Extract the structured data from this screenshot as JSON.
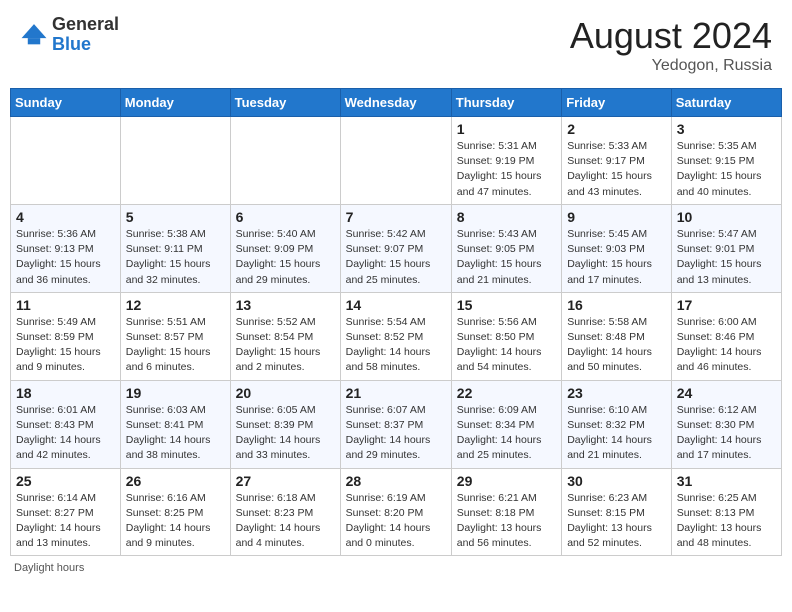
{
  "header": {
    "logo_general": "General",
    "logo_blue": "Blue",
    "month_year": "August 2024",
    "location": "Yedogon, Russia"
  },
  "days_of_week": [
    "Sunday",
    "Monday",
    "Tuesday",
    "Wednesday",
    "Thursday",
    "Friday",
    "Saturday"
  ],
  "weeks": [
    [
      {
        "num": "",
        "info": ""
      },
      {
        "num": "",
        "info": ""
      },
      {
        "num": "",
        "info": ""
      },
      {
        "num": "",
        "info": ""
      },
      {
        "num": "1",
        "info": "Sunrise: 5:31 AM\nSunset: 9:19 PM\nDaylight: 15 hours\nand 47 minutes."
      },
      {
        "num": "2",
        "info": "Sunrise: 5:33 AM\nSunset: 9:17 PM\nDaylight: 15 hours\nand 43 minutes."
      },
      {
        "num": "3",
        "info": "Sunrise: 5:35 AM\nSunset: 9:15 PM\nDaylight: 15 hours\nand 40 minutes."
      }
    ],
    [
      {
        "num": "4",
        "info": "Sunrise: 5:36 AM\nSunset: 9:13 PM\nDaylight: 15 hours\nand 36 minutes."
      },
      {
        "num": "5",
        "info": "Sunrise: 5:38 AM\nSunset: 9:11 PM\nDaylight: 15 hours\nand 32 minutes."
      },
      {
        "num": "6",
        "info": "Sunrise: 5:40 AM\nSunset: 9:09 PM\nDaylight: 15 hours\nand 29 minutes."
      },
      {
        "num": "7",
        "info": "Sunrise: 5:42 AM\nSunset: 9:07 PM\nDaylight: 15 hours\nand 25 minutes."
      },
      {
        "num": "8",
        "info": "Sunrise: 5:43 AM\nSunset: 9:05 PM\nDaylight: 15 hours\nand 21 minutes."
      },
      {
        "num": "9",
        "info": "Sunrise: 5:45 AM\nSunset: 9:03 PM\nDaylight: 15 hours\nand 17 minutes."
      },
      {
        "num": "10",
        "info": "Sunrise: 5:47 AM\nSunset: 9:01 PM\nDaylight: 15 hours\nand 13 minutes."
      }
    ],
    [
      {
        "num": "11",
        "info": "Sunrise: 5:49 AM\nSunset: 8:59 PM\nDaylight: 15 hours\nand 9 minutes."
      },
      {
        "num": "12",
        "info": "Sunrise: 5:51 AM\nSunset: 8:57 PM\nDaylight: 15 hours\nand 6 minutes."
      },
      {
        "num": "13",
        "info": "Sunrise: 5:52 AM\nSunset: 8:54 PM\nDaylight: 15 hours\nand 2 minutes."
      },
      {
        "num": "14",
        "info": "Sunrise: 5:54 AM\nSunset: 8:52 PM\nDaylight: 14 hours\nand 58 minutes."
      },
      {
        "num": "15",
        "info": "Sunrise: 5:56 AM\nSunset: 8:50 PM\nDaylight: 14 hours\nand 54 minutes."
      },
      {
        "num": "16",
        "info": "Sunrise: 5:58 AM\nSunset: 8:48 PM\nDaylight: 14 hours\nand 50 minutes."
      },
      {
        "num": "17",
        "info": "Sunrise: 6:00 AM\nSunset: 8:46 PM\nDaylight: 14 hours\nand 46 minutes."
      }
    ],
    [
      {
        "num": "18",
        "info": "Sunrise: 6:01 AM\nSunset: 8:43 PM\nDaylight: 14 hours\nand 42 minutes."
      },
      {
        "num": "19",
        "info": "Sunrise: 6:03 AM\nSunset: 8:41 PM\nDaylight: 14 hours\nand 38 minutes."
      },
      {
        "num": "20",
        "info": "Sunrise: 6:05 AM\nSunset: 8:39 PM\nDaylight: 14 hours\nand 33 minutes."
      },
      {
        "num": "21",
        "info": "Sunrise: 6:07 AM\nSunset: 8:37 PM\nDaylight: 14 hours\nand 29 minutes."
      },
      {
        "num": "22",
        "info": "Sunrise: 6:09 AM\nSunset: 8:34 PM\nDaylight: 14 hours\nand 25 minutes."
      },
      {
        "num": "23",
        "info": "Sunrise: 6:10 AM\nSunset: 8:32 PM\nDaylight: 14 hours\nand 21 minutes."
      },
      {
        "num": "24",
        "info": "Sunrise: 6:12 AM\nSunset: 8:30 PM\nDaylight: 14 hours\nand 17 minutes."
      }
    ],
    [
      {
        "num": "25",
        "info": "Sunrise: 6:14 AM\nSunset: 8:27 PM\nDaylight: 14 hours\nand 13 minutes."
      },
      {
        "num": "26",
        "info": "Sunrise: 6:16 AM\nSunset: 8:25 PM\nDaylight: 14 hours\nand 9 minutes."
      },
      {
        "num": "27",
        "info": "Sunrise: 6:18 AM\nSunset: 8:23 PM\nDaylight: 14 hours\nand 4 minutes."
      },
      {
        "num": "28",
        "info": "Sunrise: 6:19 AM\nSunset: 8:20 PM\nDaylight: 14 hours\nand 0 minutes."
      },
      {
        "num": "29",
        "info": "Sunrise: 6:21 AM\nSunset: 8:18 PM\nDaylight: 13 hours\nand 56 minutes."
      },
      {
        "num": "30",
        "info": "Sunrise: 6:23 AM\nSunset: 8:15 PM\nDaylight: 13 hours\nand 52 minutes."
      },
      {
        "num": "31",
        "info": "Sunrise: 6:25 AM\nSunset: 8:13 PM\nDaylight: 13 hours\nand 48 minutes."
      }
    ]
  ],
  "footer": {
    "daylight_hours": "Daylight hours"
  }
}
